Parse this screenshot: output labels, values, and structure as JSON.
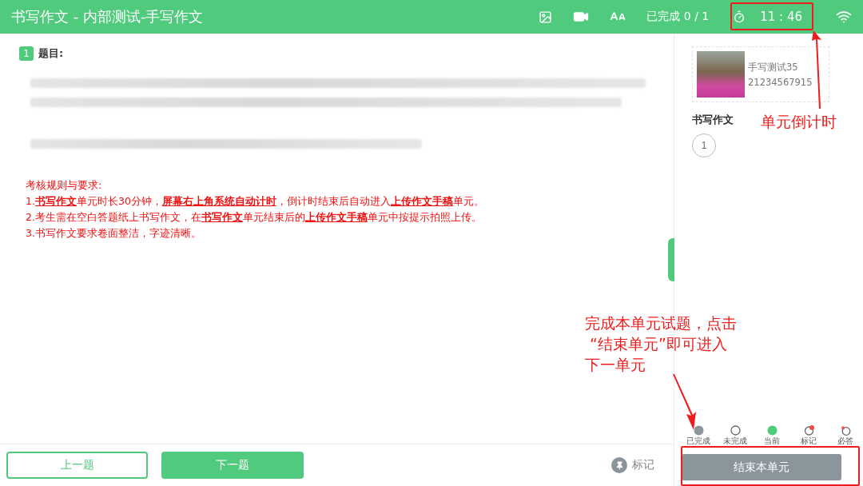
{
  "header": {
    "title": "书写作文 - 内部测试-手写作文",
    "progress": "已完成 0 / 1",
    "timer": "11 : 46"
  },
  "question": {
    "number": "1",
    "label": "题目:",
    "rules_title": "考核规则与要求:",
    "rules": [
      "1.**书写作文**单元时长30分钟，**屏幕右上角系统自动计时**，倒计时结束后自动进入**上传作文手稿**单元。",
      "2.考生需在空白答题纸上书写作文，在**书写作文**单元结束后的**上传作文手稿**单元中按提示拍照上传。",
      "3.书写作文要求卷面整洁，字迹清晰。"
    ]
  },
  "footer": {
    "prev": "上一题",
    "next": "下一题",
    "mark": "标记"
  },
  "sidebar": {
    "name": "手写测试35",
    "id": "21234567915",
    "section": "书写作文",
    "questions": [
      {
        "label": "1",
        "selected": false
      }
    ],
    "legend": [
      {
        "kind": "done",
        "label": "已完成"
      },
      {
        "kind": "todo",
        "label": "未完成"
      },
      {
        "kind": "current",
        "label": "当前"
      },
      {
        "kind": "marked",
        "label": "标记"
      },
      {
        "kind": "required",
        "label": "必答"
      }
    ],
    "end_button": "结束本单元"
  },
  "annotations": [
    {
      "text": "单元倒计时"
    },
    {
      "lines": [
        "完成本单元试题，点击",
        " “结束单元”即可进入",
        "下一单元"
      ]
    }
  ]
}
